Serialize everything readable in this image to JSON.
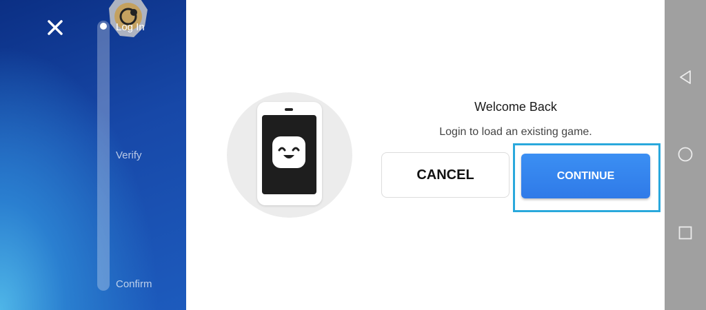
{
  "sidebar": {
    "close_icon": "close-icon",
    "steps": [
      {
        "label": "Log In",
        "active": true
      },
      {
        "label": "Verify",
        "active": false
      },
      {
        "label": "Confirm",
        "active": false
      }
    ],
    "progress": 0
  },
  "dialog": {
    "title": "Welcome Back",
    "message": "Login to load an existing game.",
    "cancel_label": "CANCEL",
    "continue_label": "CONTINUE"
  },
  "system_nav": {
    "back_icon": "back-triangle-icon",
    "home_icon": "home-circle-icon",
    "recent_icon": "recent-square-icon"
  },
  "colors": {
    "accent_blue": "#2f7ae8",
    "highlight": "#29a8dc",
    "panel_blue": "#1748a8",
    "system_bar": "#a0a0a0"
  }
}
